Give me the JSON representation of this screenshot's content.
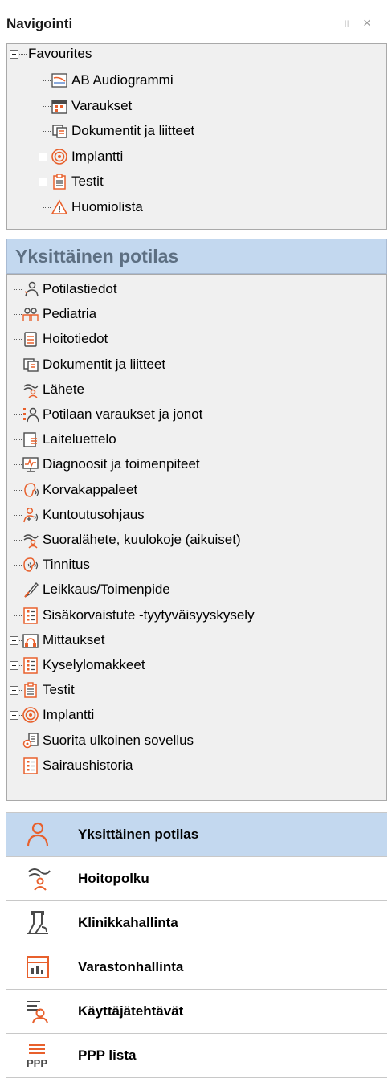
{
  "header": {
    "title": "Navigointi",
    "pin_glyph": "⫫",
    "close_glyph": "×"
  },
  "favourites": {
    "root_label": "Favourites",
    "items": [
      {
        "label": "AB Audiogrammi",
        "icon": "audiogram-icon",
        "expandable": false
      },
      {
        "label": "Varaukset",
        "icon": "calendar-icon",
        "expandable": false
      },
      {
        "label": "Dokumentit ja liitteet",
        "icon": "document-icon",
        "expandable": false
      },
      {
        "label": "Implantti",
        "icon": "implant-icon",
        "expandable": true
      },
      {
        "label": "Testit",
        "icon": "clipboard-icon",
        "expandable": true
      },
      {
        "label": "Huomiolista",
        "icon": "warning-icon",
        "expandable": false
      }
    ]
  },
  "patient_section": {
    "title": "Yksittäinen potilas",
    "items": [
      {
        "label": "Potilastiedot",
        "icon": "patient-info-icon",
        "expandable": false
      },
      {
        "label": "Pediatria",
        "icon": "pediatrics-icon",
        "expandable": false
      },
      {
        "label": "Hoitotiedot",
        "icon": "care-info-icon",
        "expandable": false
      },
      {
        "label": "Dokumentit ja liitteet",
        "icon": "document-icon",
        "expandable": false
      },
      {
        "label": "Lähete",
        "icon": "referral-icon",
        "expandable": false
      },
      {
        "label": "Potilaan varaukset ja jonot",
        "icon": "bookings-queue-icon",
        "expandable": false
      },
      {
        "label": "Laiteluettelo",
        "icon": "device-list-icon",
        "expandable": false
      },
      {
        "label": "Diagnoosit ja toimenpiteet",
        "icon": "diagnosis-icon",
        "expandable": false
      },
      {
        "label": "Korvakappaleet",
        "icon": "earmold-icon",
        "expandable": false
      },
      {
        "label": "Kuntoutusohjaus",
        "icon": "rehab-guidance-icon",
        "expandable": false
      },
      {
        "label": "Suoralähete, kuulokoje (aikuiset)",
        "icon": "direct-referral-icon",
        "expandable": false
      },
      {
        "label": "Tinnitus",
        "icon": "tinnitus-icon",
        "expandable": false
      },
      {
        "label": "Leikkaus/Toimenpide",
        "icon": "scalpel-icon",
        "expandable": false
      },
      {
        "label": "Sisäkorvaistute -tyytyväisyyskysely",
        "icon": "questionnaire-icon",
        "expandable": false
      },
      {
        "label": "Mittaukset",
        "icon": "measurements-icon",
        "expandable": true
      },
      {
        "label": "Kyselylomakkeet",
        "icon": "questionnaire-icon",
        "expandable": true
      },
      {
        "label": "Testit",
        "icon": "clipboard-icon",
        "expandable": true
      },
      {
        "label": "Implantti",
        "icon": "implant-icon",
        "expandable": true
      },
      {
        "label": "Suorita ulkoinen sovellus",
        "icon": "external-app-icon",
        "expandable": false
      },
      {
        "label": "Sairaushistoria",
        "icon": "medical-history-icon",
        "expandable": false
      }
    ]
  },
  "bottom_nav": [
    {
      "label": "Yksittäinen potilas",
      "icon": "single-patient-icon",
      "active": true
    },
    {
      "label": "Hoitopolku",
      "icon": "care-path-icon",
      "active": false
    },
    {
      "label": "Klinikkahallinta",
      "icon": "clinic-management-icon",
      "active": false
    },
    {
      "label": "Varastonhallinta",
      "icon": "inventory-icon",
      "active": false
    },
    {
      "label": "Käyttäjätehtävät",
      "icon": "user-tasks-icon",
      "active": false
    },
    {
      "label": "PPP lista",
      "icon": "ppp-list-icon",
      "active": false
    }
  ],
  "colors": {
    "accent_orange": "#e8602c",
    "dark_gray": "#4a4a4a",
    "selection_blue": "#c3d8ef",
    "panel_bg": "#f0f0f0"
  }
}
